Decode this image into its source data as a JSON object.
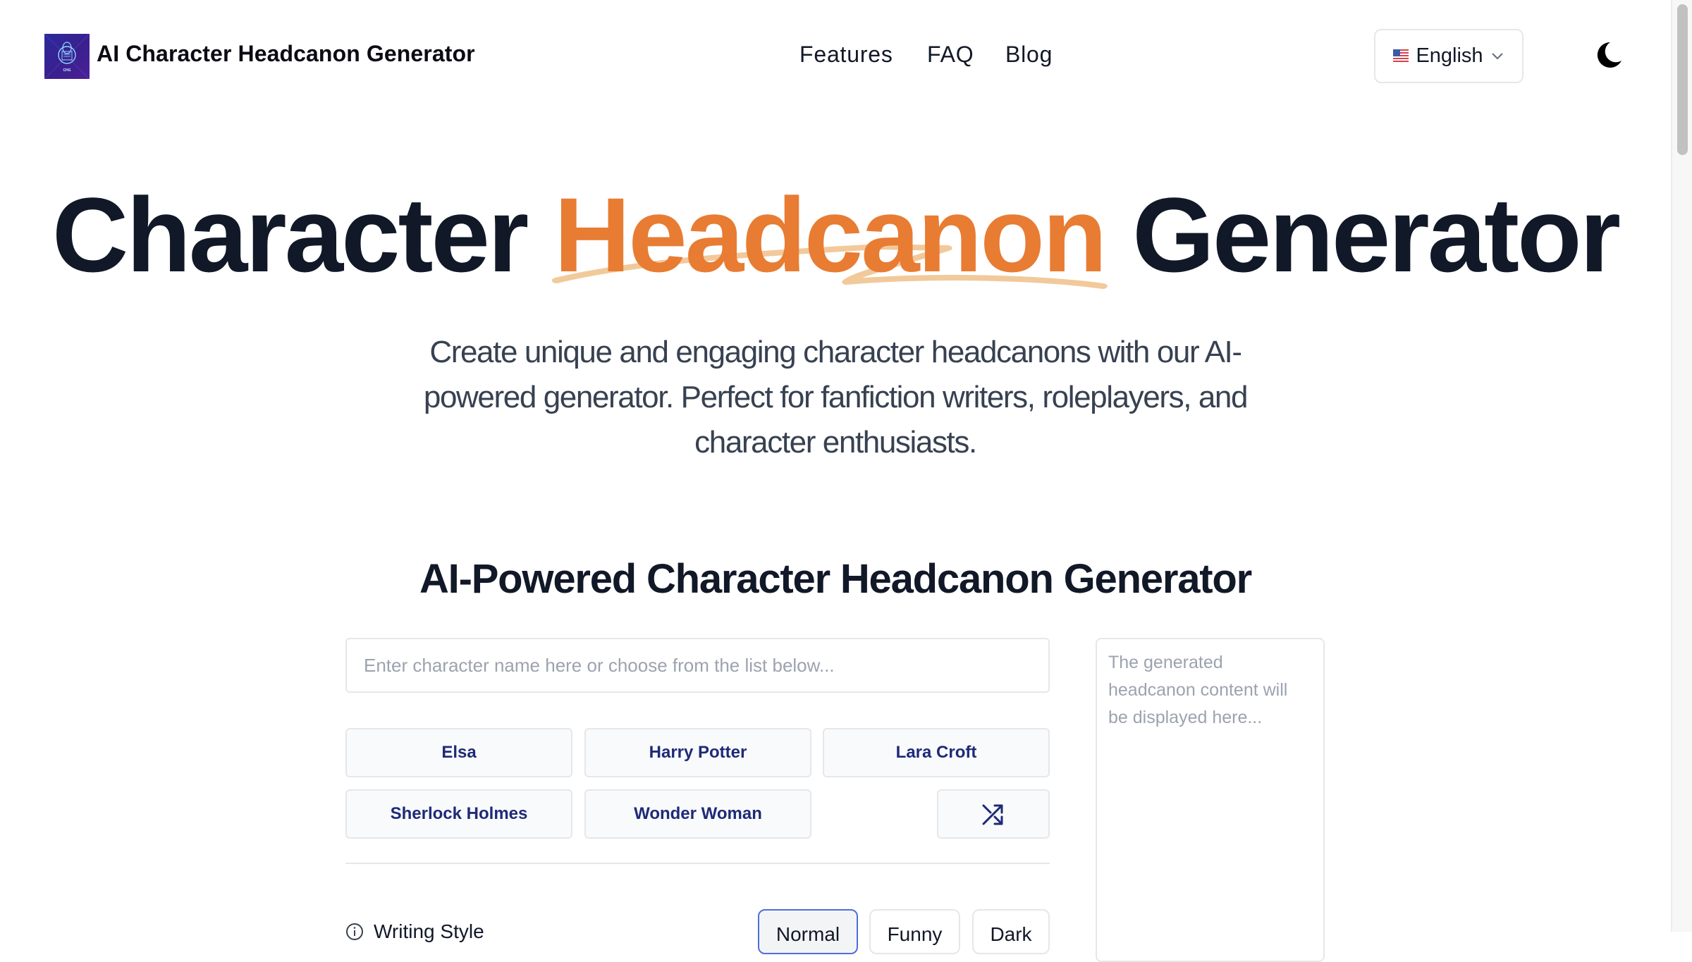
{
  "header": {
    "logo_icon": "ai-character-logo",
    "site_title": "AI Character Headcanon Generator",
    "nav": [
      {
        "label": "Features"
      },
      {
        "label": "FAQ"
      },
      {
        "label": "Blog"
      }
    ],
    "language": {
      "flag_icon": "us-flag-icon",
      "label": "English",
      "chevron_icon": "chevron-down-icon"
    },
    "theme_toggle_icon": "moon-icon"
  },
  "hero": {
    "title_before": "Character ",
    "title_accent": "Headcanon",
    "title_after": " Generator",
    "subtitle": "Create unique and engaging character headcanons with our AI-powered generator. Perfect for fanfiction writers, roleplayers, and character enthusiasts."
  },
  "generator": {
    "section_title": "AI-Powered Character Headcanon Generator",
    "input": {
      "value": "",
      "placeholder": "Enter character name here or choose from the list below..."
    },
    "characters": [
      "Elsa",
      "Harry Potter",
      "Lara Croft",
      "Sherlock Holmes",
      "Wonder Woman"
    ],
    "shuffle_icon": "shuffle-icon",
    "writing_style": {
      "label": "Writing Style",
      "icon": "info-circle-icon",
      "options": [
        "Normal",
        "Funny",
        "Dark"
      ],
      "selected": "Normal"
    },
    "output_placeholder": "The generated headcanon content will be displayed here..."
  },
  "colors": {
    "accent": "#e87c33",
    "accent_underline": "#f2c99a",
    "heading": "#111827",
    "char_button_text": "#1e2a78",
    "active_border": "#4f6fd8"
  }
}
